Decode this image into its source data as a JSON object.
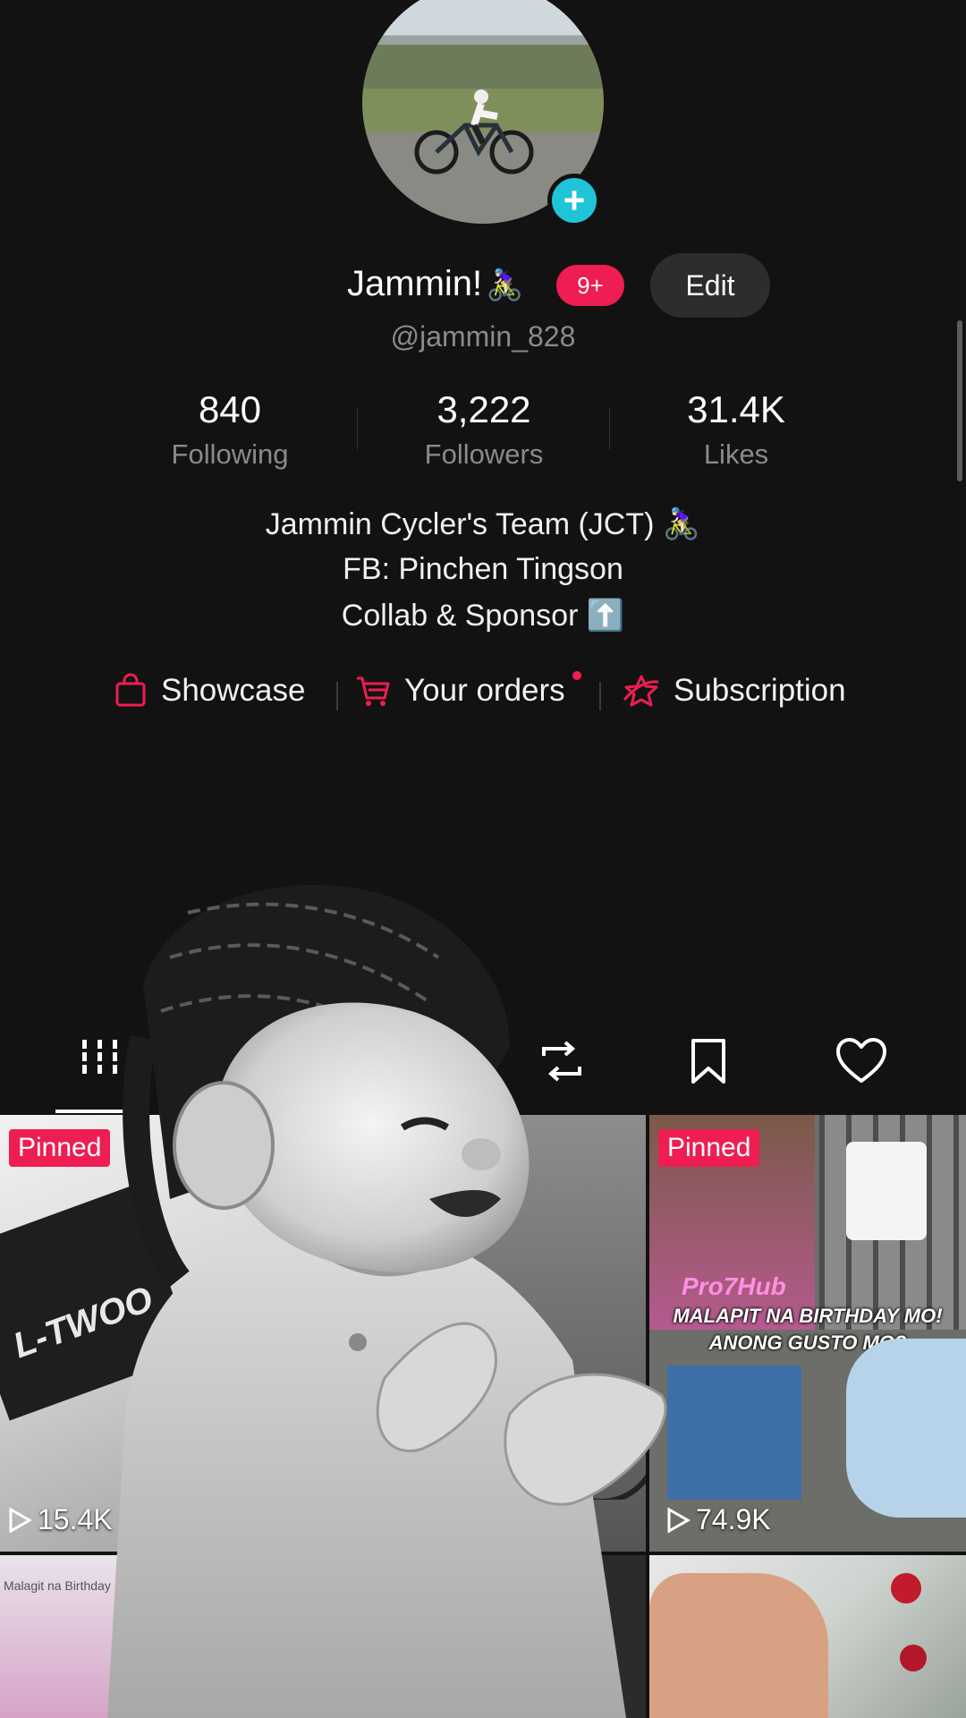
{
  "profile": {
    "display_name": "Jammin!",
    "name_emoji": "🚴🏻‍♀️",
    "notification_badge": "9+",
    "edit_label": "Edit",
    "handle": "@jammin_828"
  },
  "stats": [
    {
      "value": "840",
      "label": "Following"
    },
    {
      "value": "3,222",
      "label": "Followers"
    },
    {
      "value": "31.4K",
      "label": "Likes"
    }
  ],
  "bio": {
    "line1": "Jammin Cycler's Team (JCT) 🚴🏻‍♀️",
    "line2": "FB: Pinchen Tingson",
    "line3": "Collab & Sponsor ⬆️"
  },
  "links": {
    "showcase": "Showcase",
    "orders": "Your orders",
    "subscription": "Subscription"
  },
  "grid": {
    "pinned_label": "Pinned",
    "tile1_views": "15.4K",
    "tile1_text": "L-TWOO",
    "tile3_views": "74.9K",
    "tile3_brand": "Pro7Hub",
    "tile3_caption1": "MALAPIT NA BIRTHDAY MO!",
    "tile3_caption2": "ANONG GUSTO MO?",
    "tile4_text": "Malagit na Birthday"
  },
  "colors": {
    "accent": "#ee1d52",
    "avatar_plus": "#20c4d8",
    "background": "#121212"
  }
}
